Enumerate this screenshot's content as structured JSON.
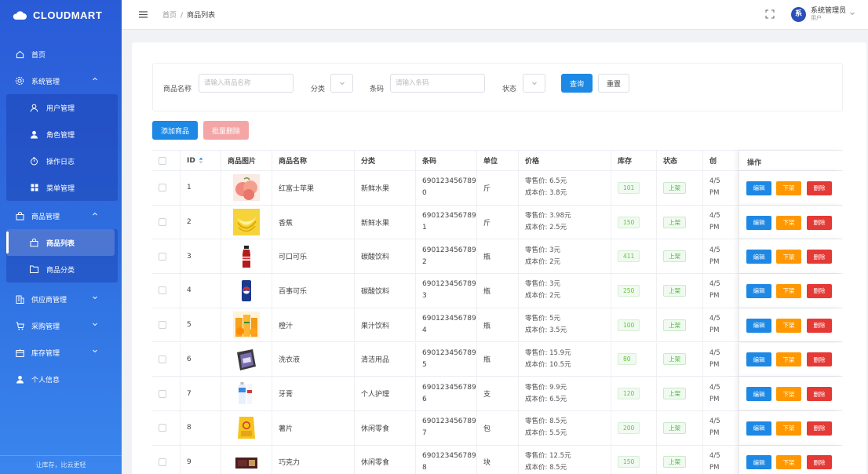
{
  "brand": {
    "name": "CLOUDMART"
  },
  "sidebar": {
    "items": [
      {
        "label": "首页",
        "icon": "home-icon"
      },
      {
        "label": "系统管理",
        "icon": "gear-icon",
        "expanded": true,
        "children": [
          {
            "label": "用户管理",
            "icon": "user-outline-icon"
          },
          {
            "label": "角色管理",
            "icon": "user-solid-icon"
          },
          {
            "label": "操作日志",
            "icon": "timer-icon"
          },
          {
            "label": "菜单管理",
            "icon": "grid-icon"
          }
        ]
      },
      {
        "label": "商品管理",
        "icon": "bag-icon",
        "expanded": true,
        "children": [
          {
            "label": "商品列表",
            "icon": "bag-icon",
            "active": true
          },
          {
            "label": "商品分类",
            "icon": "folder-icon"
          }
        ]
      },
      {
        "label": "供应商管理",
        "icon": "building-icon"
      },
      {
        "label": "采购管理",
        "icon": "cart-icon"
      },
      {
        "label": "库存管理",
        "icon": "box-icon"
      },
      {
        "label": "个人信息",
        "icon": "person-icon"
      }
    ],
    "footer": "让库存，比云更轻"
  },
  "header": {
    "breadcrumb": [
      "首页",
      "商品列表"
    ],
    "user_name": "系统管理员",
    "user_role": "用户",
    "avatar_text": "系"
  },
  "filters": {
    "name_label": "商品名称",
    "name_placeholder": "请输入商品名称",
    "category_label": "分类",
    "barcode_label": "条码",
    "barcode_placeholder": "请输入条码",
    "status_label": "状态",
    "query_label": "查询",
    "reset_label": "重置"
  },
  "actions": {
    "add_label": "添加商品",
    "batch_delete_label": "批量删除"
  },
  "table": {
    "columns": [
      "ID",
      "商品图片",
      "商品名称",
      "分类",
      "条码",
      "单位",
      "价格",
      "库存",
      "状态",
      "创",
      "操作"
    ],
    "ops": {
      "edit": "编辑",
      "off_shelf": "下架",
      "delete": "删除"
    },
    "rows": [
      {
        "id": "1",
        "image": "apple",
        "name": "红富士苹果",
        "category": "新鲜水果",
        "barcode_a": "690123456789",
        "barcode_b": "0",
        "unit": "斤",
        "retail": "零售价: 6.5元",
        "cost": "成本价: 3.8元",
        "stock": "101",
        "status": "上架",
        "created_a": "4/5",
        "created_b": "PM"
      },
      {
        "id": "2",
        "image": "banana",
        "name": "香蕉",
        "category": "新鲜水果",
        "barcode_a": "690123456789",
        "barcode_b": "1",
        "unit": "斤",
        "retail": "零售价: 3.98元",
        "cost": "成本价: 2.5元",
        "stock": "150",
        "status": "上架",
        "created_a": "4/5",
        "created_b": "PM"
      },
      {
        "id": "3",
        "image": "cola",
        "name": "可口可乐",
        "category": "碳酸饮料",
        "barcode_a": "690123456789",
        "barcode_b": "2",
        "unit": "瓶",
        "retail": "零售价: 3元",
        "cost": "成本价: 2元",
        "stock": "411",
        "status": "上架",
        "created_a": "4/5",
        "created_b": "PM"
      },
      {
        "id": "4",
        "image": "pepsi",
        "name": "百事可乐",
        "category": "碳酸饮料",
        "barcode_a": "690123456789",
        "barcode_b": "3",
        "unit": "瓶",
        "retail": "零售价: 3元",
        "cost": "成本价: 2元",
        "stock": "250",
        "status": "上架",
        "created_a": "4/5",
        "created_b": "PM"
      },
      {
        "id": "5",
        "image": "juice",
        "name": "橙汁",
        "category": "果汁饮料",
        "barcode_a": "690123456789",
        "barcode_b": "4",
        "unit": "瓶",
        "retail": "零售价: 5元",
        "cost": "成本价: 3.5元",
        "stock": "100",
        "status": "上架",
        "created_a": "4/5",
        "created_b": "PM"
      },
      {
        "id": "6",
        "image": "detergent",
        "name": "洗衣液",
        "category": "清洁用品",
        "barcode_a": "690123456789",
        "barcode_b": "5",
        "unit": "瓶",
        "retail": "零售价: 15.9元",
        "cost": "成本价: 10.5元",
        "stock": "80",
        "status": "上架",
        "created_a": "4/5",
        "created_b": "PM"
      },
      {
        "id": "7",
        "image": "toothpaste",
        "name": "牙膏",
        "category": "个人护理",
        "barcode_a": "690123456789",
        "barcode_b": "6",
        "unit": "支",
        "retail": "零售价: 9.9元",
        "cost": "成本价: 6.5元",
        "stock": "120",
        "status": "上架",
        "created_a": "4/5",
        "created_b": "PM"
      },
      {
        "id": "8",
        "image": "chips",
        "name": "薯片",
        "category": "休闲零食",
        "barcode_a": "690123456789",
        "barcode_b": "7",
        "unit": "包",
        "retail": "零售价: 8.5元",
        "cost": "成本价: 5.5元",
        "stock": "200",
        "status": "上架",
        "created_a": "4/5",
        "created_b": "PM"
      },
      {
        "id": "9",
        "image": "chocolate",
        "name": "巧克力",
        "category": "休闲零食",
        "barcode_a": "690123456789",
        "barcode_b": "8",
        "unit": "块",
        "retail": "零售价: 12.5元",
        "cost": "成本价: 8.5元",
        "stock": "150",
        "status": "上架",
        "created_a": "4/5",
        "created_b": "PM"
      }
    ]
  },
  "colors": {
    "primary": "#1e88e5",
    "warning": "#ff9800",
    "danger": "#e53935",
    "success": "#52b545",
    "sidebar": "#2a5bd7"
  }
}
